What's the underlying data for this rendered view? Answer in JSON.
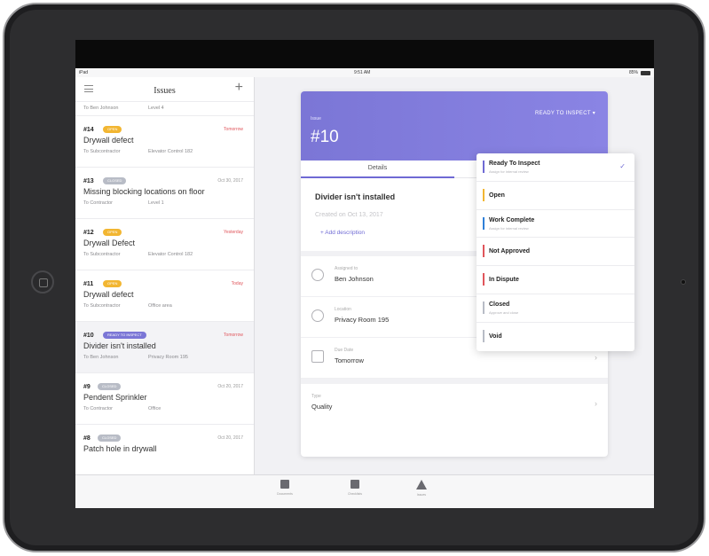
{
  "statusbar": {
    "device": "iPad",
    "time": "9:51 AM",
    "battery": "85%"
  },
  "sidebar": {
    "title": "Issues",
    "first_row": {
      "assignee": "To Ben Johnson",
      "location": "Level 4"
    },
    "issues": [
      {
        "num": "#14",
        "badge": "Open",
        "badge_color": "#f2b632",
        "due": "Tomorrow",
        "due_red": true,
        "title": "Drywall defect",
        "assignee": "To Subcontractor",
        "location": "Elevator Control 182"
      },
      {
        "num": "#13",
        "badge": "Closed",
        "badge_color": "#b8bcc6",
        "due": "Oct 30, 2017",
        "due_red": false,
        "title": "Missing blocking locations on floor",
        "assignee": "To Contractor",
        "location": "Level 1"
      },
      {
        "num": "#12",
        "badge": "Open",
        "badge_color": "#f2b632",
        "due": "Yesterday",
        "due_red": true,
        "title": "Drywall Defect",
        "assignee": "To Subcontractor",
        "location": "Elevator Control 182"
      },
      {
        "num": "#11",
        "badge": "Open",
        "badge_color": "#f2b632",
        "due": "Today",
        "due_red": true,
        "title": "Drywall defect",
        "assignee": "To Subcontractor",
        "location": "Office area"
      },
      {
        "num": "#10",
        "badge": "Ready to inspect",
        "badge_color": "#7b76d6",
        "due": "Tomorrow",
        "due_red": true,
        "title": "Divider isn't installed",
        "assignee": "To Ben Johnson",
        "location": "Privacy Room 195",
        "selected": true
      },
      {
        "num": "#9",
        "badge": "Closed",
        "badge_color": "#b8bcc6",
        "due": "Oct 20, 2017",
        "due_red": false,
        "title": "Pendent Sprinkler",
        "assignee": "To Contractor",
        "location": "Office"
      },
      {
        "num": "#8",
        "badge": "Closed",
        "badge_color": "#b8bcc6",
        "due": "Oct 20, 2017",
        "due_red": false,
        "title": "Patch hole in drywall",
        "assignee": "",
        "location": ""
      }
    ]
  },
  "detail": {
    "issue_label": "Issue",
    "issue_num": "#10",
    "status": "READY TO INSPECT",
    "tab_details": "Details",
    "title": "Divider isn't installed",
    "created": "Created on Oct 13, 2017",
    "add_description": "+ Add description",
    "assigned_label": "Assigned to",
    "assigned_value": "Ben Johnson",
    "location_label": "Location",
    "location_value": "Privacy Room 195",
    "due_label": "Due Date",
    "due_value": "Tomorrow",
    "type_label": "Type",
    "type_value": "Quality"
  },
  "dropdown": {
    "items": [
      {
        "label": "Ready To Inspect",
        "sub": "Assign for internal review",
        "color": "#6f6ad4",
        "checked": true
      },
      {
        "label": "Open",
        "sub": "",
        "color": "#f2b632",
        "checked": false
      },
      {
        "label": "Work Complete",
        "sub": "Assign for internal review",
        "color": "#2f7fd8",
        "checked": false
      },
      {
        "label": "Not Approved",
        "sub": "",
        "color": "#e0555b",
        "checked": false
      },
      {
        "label": "In Dispute",
        "sub": "",
        "color": "#e0555b",
        "checked": false
      },
      {
        "label": "Closed",
        "sub": "Approve and close",
        "color": "#b8bcc6",
        "checked": false
      },
      {
        "label": "Void",
        "sub": "",
        "color": "#b8bcc6",
        "checked": false
      }
    ]
  },
  "tabbar": {
    "documents": "Documents",
    "checklists": "Checklists",
    "issues": "Issues"
  }
}
